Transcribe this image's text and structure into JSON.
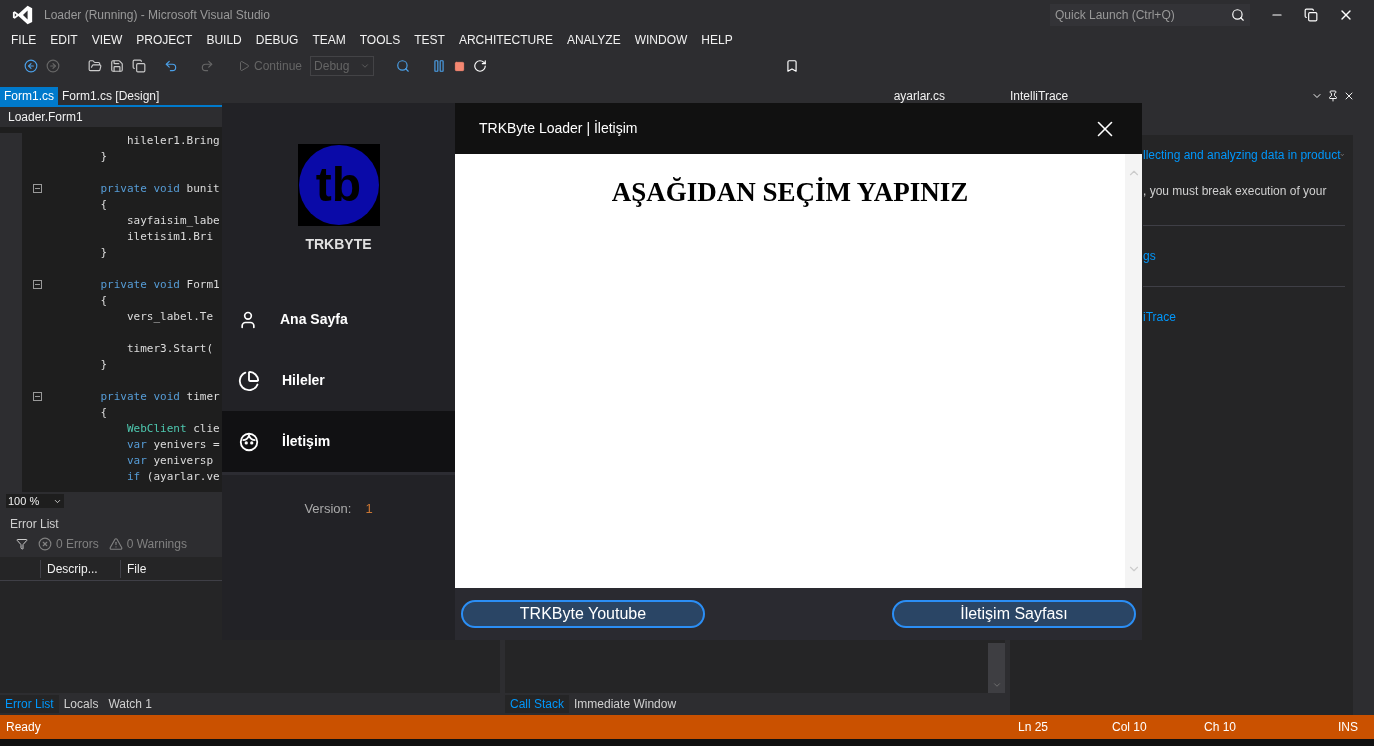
{
  "window": {
    "title": "Loader (Running) - Microsoft Visual Studio",
    "quick_launch": {
      "placeholder": "Quick Launch (Ctrl+Q)"
    }
  },
  "menu": [
    "FILE",
    "EDIT",
    "VIEW",
    "PROJECT",
    "BUILD",
    "DEBUG",
    "TEAM",
    "TOOLS",
    "TEST",
    "ARCHITECTURE",
    "ANALYZE",
    "WINDOW",
    "HELP"
  ],
  "toolbar": {
    "continue": {
      "label": "Continue",
      "disabled": true
    },
    "configuration": {
      "value": "Debug",
      "disabled": true
    }
  },
  "document_tabs": [
    {
      "label": "Form1.cs",
      "selected": true
    },
    {
      "label": "Form1.cs [Design]",
      "selected": false
    }
  ],
  "side_document_tab": {
    "label": "ayarlar.cs"
  },
  "navigation_bar": {
    "label": "Loader.Form1"
  },
  "code_lines": [
    {
      "collapsible": false,
      "tokens": [
        {
          "kind": "plain",
          "text": "        hileler1.Bring"
        }
      ]
    },
    {
      "collapsible": false,
      "tokens": [
        {
          "kind": "plain",
          "text": "    }"
        }
      ]
    },
    {
      "kind": "blank"
    },
    {
      "collapsible": true,
      "tokens": [
        {
          "kind": "keyword",
          "text": "    private void "
        },
        {
          "kind": "plain",
          "text": "bunit"
        }
      ]
    },
    {
      "collapsible": false,
      "tokens": [
        {
          "kind": "plain",
          "text": "    {"
        }
      ]
    },
    {
      "collapsible": false,
      "tokens": [
        {
          "kind": "plain",
          "text": "        sayfaisim_labe"
        }
      ]
    },
    {
      "collapsible": false,
      "tokens": [
        {
          "kind": "plain",
          "text": "        iletisim1.Bri"
        }
      ]
    },
    {
      "collapsible": false,
      "tokens": [
        {
          "kind": "plain",
          "text": "    }"
        }
      ]
    },
    {
      "kind": "blank"
    },
    {
      "collapsible": true,
      "tokens": [
        {
          "kind": "keyword",
          "text": "    private void "
        },
        {
          "kind": "plain",
          "text": "Form1"
        }
      ]
    },
    {
      "collapsible": false,
      "tokens": [
        {
          "kind": "plain",
          "text": "    {"
        }
      ]
    },
    {
      "collapsible": false,
      "tokens": [
        {
          "kind": "plain",
          "text": "        vers_label.Te"
        }
      ]
    },
    {
      "kind": "blank"
    },
    {
      "collapsible": false,
      "tokens": [
        {
          "kind": "plain",
          "text": "        timer3.Start("
        }
      ]
    },
    {
      "collapsible": false,
      "tokens": [
        {
          "kind": "plain",
          "text": "    }"
        }
      ]
    },
    {
      "kind": "blank"
    },
    {
      "collapsible": true,
      "tokens": [
        {
          "kind": "keyword",
          "text": "    private void "
        },
        {
          "kind": "plain",
          "text": "timer"
        }
      ]
    },
    {
      "collapsible": false,
      "tokens": [
        {
          "kind": "plain",
          "text": "    {"
        }
      ]
    },
    {
      "collapsible": false,
      "tokens": [
        {
          "kind": "type",
          "text": "        WebClient "
        },
        {
          "kind": "plain",
          "text": "clie"
        }
      ]
    },
    {
      "collapsible": false,
      "tokens": [
        {
          "kind": "keyword",
          "text": "        var "
        },
        {
          "kind": "plain",
          "text": "yenivers ="
        }
      ]
    },
    {
      "collapsible": false,
      "tokens": [
        {
          "kind": "keyword",
          "text": "        var "
        },
        {
          "kind": "plain",
          "text": "yeniversp"
        }
      ]
    },
    {
      "collapsible": false,
      "tokens": [
        {
          "kind": "keyword",
          "text": "        if "
        },
        {
          "kind": "plain",
          "text": "(ayarlar.ve"
        }
      ]
    }
  ],
  "zoom": {
    "value": "100 %"
  },
  "error_list": {
    "title": "Error List",
    "errors": "0 Errors",
    "warnings": "0 Warnings",
    "columns": [
      "Descrip...",
      "File"
    ]
  },
  "bottom_left_tabs": [
    {
      "label": "Error List",
      "selected": true
    },
    {
      "label": "Locals",
      "selected": false
    },
    {
      "label": "Watch 1",
      "selected": false
    }
  ],
  "bottom_right_tabs": [
    {
      "label": "Call Stack",
      "selected": true
    },
    {
      "label": "Immediate Window",
      "selected": false
    }
  ],
  "intellitrace": {
    "title": "IntelliTrace",
    "lines": [
      {
        "kind": "link",
        "text": "llecting and analyzing data in product"
      },
      {
        "kind": "text",
        "text": ", you must break execution of your"
      },
      {
        "kind": "divider"
      },
      {
        "kind": "link",
        "text": "gs"
      },
      {
        "kind": "divider"
      },
      {
        "kind": "link",
        "text": "iTrace"
      }
    ]
  },
  "status_bar": {
    "message": "Ready",
    "line": "Ln 25",
    "column": "Col 10",
    "char": "Ch 10",
    "mode": "INS"
  },
  "loader": {
    "title": "TRKByte Loader | İletişim",
    "logo_text": "tb",
    "brand": "TRKBYTE",
    "nav": [
      {
        "kind": "user",
        "label": "Ana Sayfa",
        "selected": false
      },
      {
        "kind": "pie",
        "label": "Hileler",
        "selected": false
      },
      {
        "kind": "contact",
        "label": "İletişim",
        "selected": true
      }
    ],
    "version_label": "Version:",
    "version": "1",
    "heading": "AŞAĞIDAN SEÇİM YAPINIZ",
    "buttons": [
      "TRKByte Youtube",
      "İletişim Sayfası"
    ]
  }
}
